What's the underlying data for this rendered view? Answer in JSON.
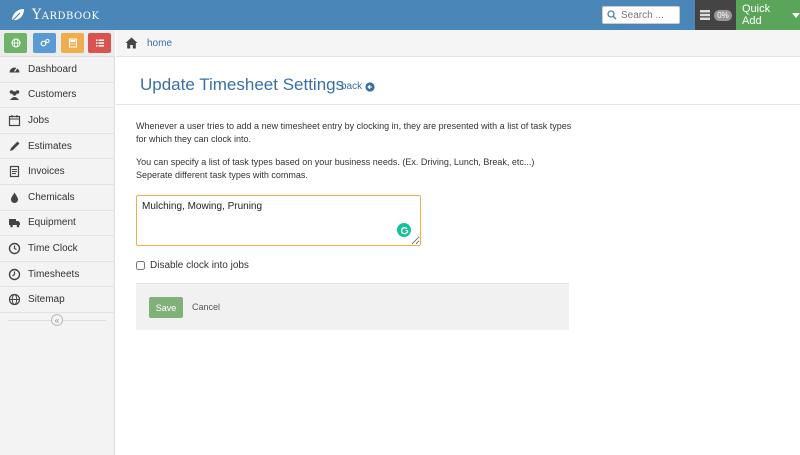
{
  "brand": {
    "name": "Yardbook"
  },
  "search": {
    "placeholder": "Search ..."
  },
  "status": {
    "percent_badge": "0%"
  },
  "quick_add": {
    "label": "Quick Add"
  },
  "shortcuts": [
    {
      "icon": "globe-icon",
      "color": "#6fb36b"
    },
    {
      "icon": "gears-icon",
      "color": "#5b9bd5"
    },
    {
      "icon": "calculator-icon",
      "color": "#f0ad4e"
    },
    {
      "icon": "list-icon",
      "color": "#d9534f"
    }
  ],
  "sidebar": {
    "items": [
      {
        "label": "Dashboard",
        "icon": "dashboard-icon"
      },
      {
        "label": "Customers",
        "icon": "customers-icon"
      },
      {
        "label": "Jobs",
        "icon": "calendar-icon"
      },
      {
        "label": "Estimates",
        "icon": "pencil-icon"
      },
      {
        "label": "Invoices",
        "icon": "invoice-icon"
      },
      {
        "label": "Chemicals",
        "icon": "droplet-icon"
      },
      {
        "label": "Equipment",
        "icon": "truck-icon"
      },
      {
        "label": "Time Clock",
        "icon": "clock-icon"
      },
      {
        "label": "Timesheets",
        "icon": "timesheet-icon"
      },
      {
        "label": "Sitemap",
        "icon": "globe-icon"
      }
    ],
    "collapse_glyph": "«"
  },
  "breadcrumb": {
    "home_label": "home"
  },
  "page": {
    "title": "Update Timesheet Settings",
    "back_label": "back"
  },
  "content": {
    "intro": "Whenever a user tries to add a new timesheet entry by clocking in, they are presented with a list of task types for which they can clock into.",
    "instruction1": "You can specify a list of task types based on your business needs. (Ex. Driving, Lunch, Break, etc...)",
    "instruction2": "Seperate different task types with commas.",
    "task_types_value": "Mulching, Mowing, Pruning",
    "disable_clock_label": "Disable clock into jobs",
    "disable_clock_checked": false
  },
  "actions": {
    "save_label": "Save",
    "cancel_label": "Cancel"
  },
  "colors": {
    "navbar": "#4a86b8",
    "quick_add": "#5aa55a",
    "link": "#3a6fa6",
    "save": "#7fb178",
    "textarea_border": "#f0ad4e"
  }
}
